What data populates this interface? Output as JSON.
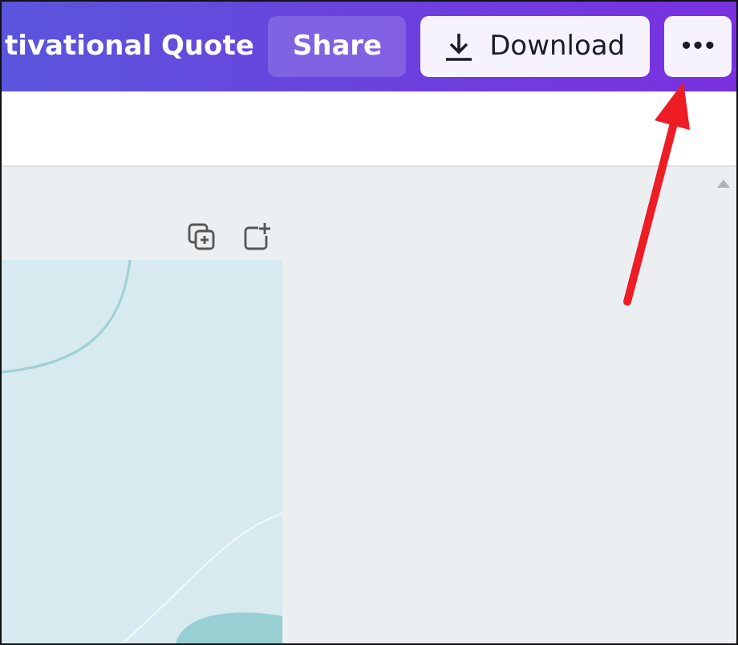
{
  "header": {
    "title": "tivational Quote",
    "buttons": [
      {
        "kind": "share",
        "label": "Share"
      },
      {
        "kind": "download",
        "label": "Download"
      },
      {
        "kind": "more",
        "label": "•••"
      }
    ]
  }
}
